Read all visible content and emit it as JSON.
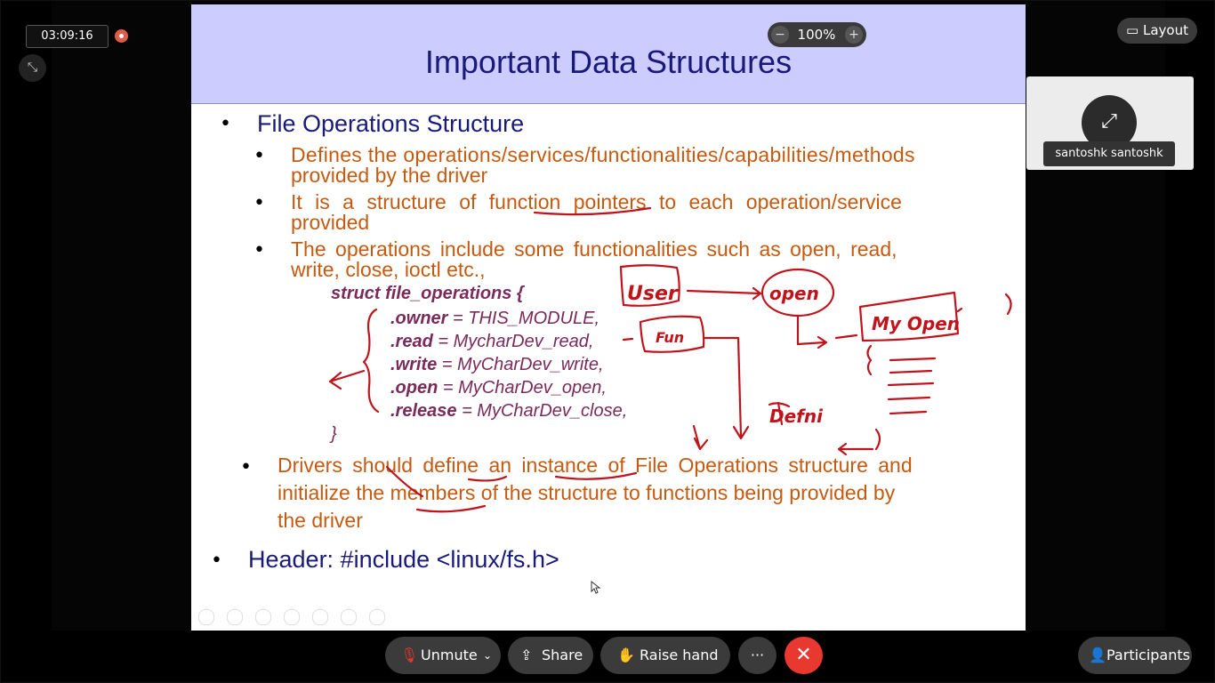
{
  "meeting": {
    "timer": "03:09:16",
    "layout_label": "Layout",
    "participant_name": "santoshk santoshk"
  },
  "zoom": {
    "value": "100%",
    "minus": "−",
    "plus": "+"
  },
  "slide": {
    "title": "Important Data Structures",
    "bullet1": "File Operations Structure",
    "sub1a": "Defines the operations/services/functionalities/capabilities/methods",
    "sub1b": "provided by the driver",
    "sub2a": "It is a structure of function pointers to each operation/service",
    "sub2b": "provided",
    "sub3a": "The operations include some functionalities such as open, read,",
    "sub3b": "write, close, ioctl etc.,",
    "code": {
      "line0": "struct file_operations {",
      "owner_key": ".owner",
      "owner_val": " = THIS_MODULE,",
      "read_key": ".read",
      "read_val": "  = MycharDev_read,",
      "write_key": ".write",
      "write_val": " = MyCharDev_write,",
      "open_key": ".open",
      "open_val": " = MyCharDev_open,",
      "release_key": ".release",
      "release_val": " = MyCharDev_close,",
      "close": "}"
    },
    "sub4a": "Drivers should define an instance of File Operations structure and",
    "sub4b": "initialize the members of the structure to functions being provided by",
    "sub4c": "the driver",
    "bullet2": "Header: #include <linux/fs.h>"
  },
  "annotations": {
    "user": "User",
    "open": "open",
    "fun": "Fun",
    "myopen": "My Open",
    "defni": "Defni"
  },
  "controls": {
    "unmute": "Unmute",
    "share": "Share",
    "raise_hand": "Raise hand",
    "more": "···",
    "participants": "Participants"
  },
  "colors": {
    "accent_red": "#e8382f",
    "ink": "#c0141c",
    "slide_text": "#c55a11",
    "slide_heading": "#1a1a7a"
  }
}
